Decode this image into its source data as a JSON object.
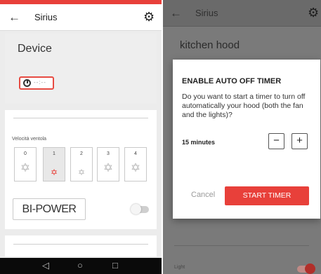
{
  "left": {
    "header": {
      "back_icon": "arrow-left-icon",
      "title": "Sirius",
      "settings_icon": "gear-icon"
    },
    "device": {
      "title": "Device",
      "timer_display": "--:--",
      "power_on": true
    },
    "fan": {
      "label": "Velocità ventola",
      "speeds": [
        "0",
        "1",
        "2",
        "3",
        "4"
      ],
      "selected": "1",
      "bipower_label": "BI-POWER",
      "bipower_on": false
    },
    "nav": {
      "back_icon": "triangle-back-icon",
      "home_icon": "circle-home-icon",
      "recent_icon": "square-recent-icon"
    }
  },
  "right": {
    "header": {
      "back_icon": "arrow-left-icon",
      "title": "Sirius",
      "settings_icon": "gear-icon"
    },
    "device_name": "kitchen hood",
    "light_label": "Light",
    "light_on": true,
    "dialog": {
      "title": "ENABLE AUTO OFF TIMER",
      "body": "Do you want to start a timer to turn off automatically your hood (both the fan and the lights)?",
      "duration": "15 minutes",
      "minus": "−",
      "plus": "+",
      "cancel": "Cancel",
      "confirm": "START TIMER"
    }
  },
  "colors": {
    "accent": "#e8403a",
    "scrim": "#7a7a7a"
  }
}
